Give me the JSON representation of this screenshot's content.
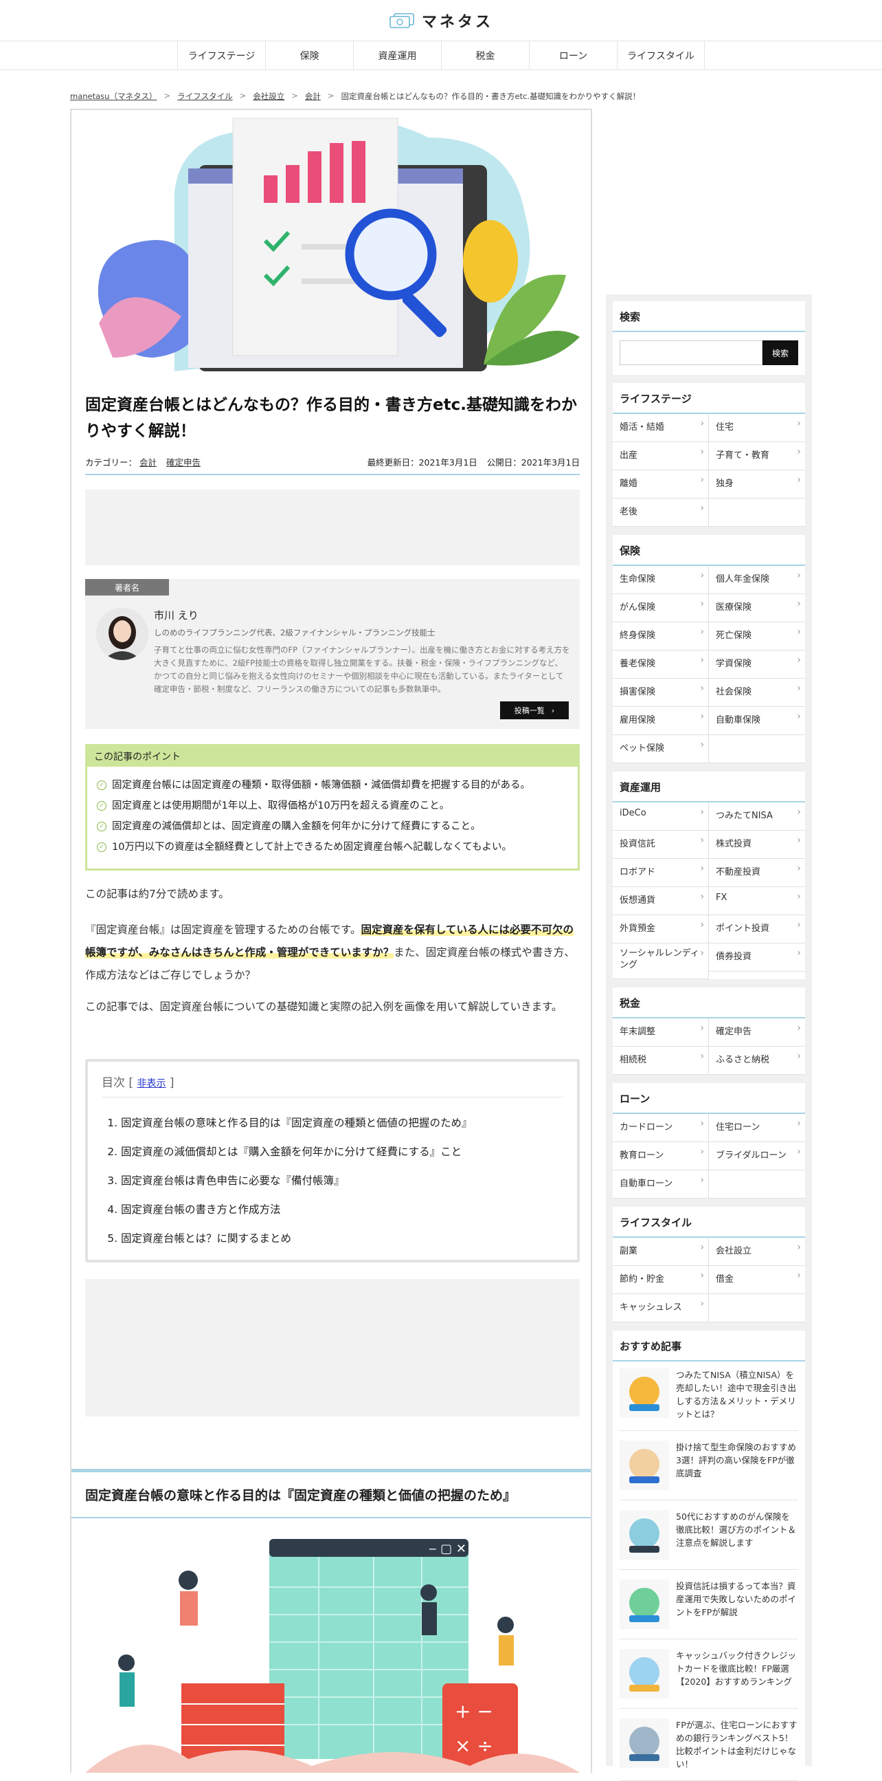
{
  "site": {
    "logo_text": "マネタス"
  },
  "nav": [
    "ライフステージ",
    "保険",
    "資産運用",
    "税金",
    "ローン",
    "ライフスタイル"
  ],
  "breadcrumb": [
    "manetasu（マネタス）",
    "ライフスタイル",
    "会社設立",
    "会計",
    "固定資産台帳とはどんなもの？作る目的・書き方etc.基礎知識をわかりやすく解説！"
  ],
  "breadcrumb_sep": ">",
  "article": {
    "title": "固定資産台帳とはどんなもの？作る目的・書き方etc.基礎知識をわかりやすく解説！",
    "category_label": "カテゴリー：",
    "categories": [
      "会計",
      "確定申告"
    ],
    "updated": "最終更新日：2021年3月1日",
    "published": "公開日：2021年3月1日",
    "author_tag": "著者名",
    "author_name": "市川 えり",
    "author_role": "しのめのライフプランニング代表、2級ファイナンシャル・プランニング技能士",
    "author_bio": "子育てと仕事の両立に悩む女性専門のFP（ファイナンシャルプランナー）。出産を機に働き方とお金に対する考え方を大きく見直すために、2級FP技能士の資格を取得し独立開業をする。扶養・税金・保険・ライフプランニングなど、かつての自分と同じ悩みを抱える女性向けのセミナーや個別相談を中心に現在も活動している。またライターとして確定申告・節税・制度など、フリーランスの働き方についての記事も多数執筆中。",
    "posts_button": "投稿一覧",
    "points_title": "この記事のポイント",
    "points": [
      "固定資産台帳には固定資産の種類・取得価額・帳簿価額・減価償却費を把握する目的がある。",
      "固定資産とは使用期間が1年以上、取得価格が10万円を超える資産のこと。",
      "固定資産の減価償却とは、固定資産の購入金額を何年かに分けて経費にすること。",
      "10万円以下の資産は全額経費として計上できるため固定資産台帳へ記載しなくてもよい。"
    ],
    "read_time": "この記事は約7分で読めます。",
    "intro_a": "『固定資産台帳』は固定資産を管理するための台帳です。",
    "intro_hl": "固定資産を保有している人には必要不可欠の帳簿ですが、みなさんはきちんと作成・管理ができていますか？",
    "intro_b": "また、固定資産台帳の様式や書き方、作成方法などはご存じでしょうか？",
    "intro2": "この記事では、固定資産台帳についての基礎知識と実際の記入例を画像を用いて解説していきます。",
    "toc_title": "目次",
    "toc_toggle": "非表示",
    "toc": [
      "固定資産台帳の意味と作る目的は『固定資産の種類と価値の把握のため』",
      "固定資産の減価償却とは『購入金額を何年かに分けて経費にする』こと",
      "固定資産台帳は青色申告に必要な『備付帳簿』",
      "固定資産台帳の書き方と作成方法",
      "固定資産台帳とは？に関するまとめ"
    ],
    "h2_1": "固定資産台帳の意味と作る目的は『固定資産の種類と価値の把握のため』"
  },
  "sidebar": {
    "search_title": "検索",
    "search_button": "検索",
    "categories": [
      {
        "title": "ライフステージ",
        "items": [
          "婚活・結婚",
          "住宅",
          "出産",
          "子育て・教育",
          "離婚",
          "独身",
          "老後",
          ""
        ]
      },
      {
        "title": "保険",
        "items": [
          "生命保険",
          "個人年金保険",
          "がん保険",
          "医療保険",
          "終身保険",
          "死亡保険",
          "養老保険",
          "学資保険",
          "損害保険",
          "社会保険",
          "雇用保険",
          "自動車保険",
          "ペット保険",
          ""
        ]
      },
      {
        "title": "資産運用",
        "items": [
          "iDeCo",
          "つみたてNISA",
          "投資信託",
          "株式投資",
          "ロボアド",
          "不動産投資",
          "仮想通貨",
          "FX",
          "外貨預金",
          "ポイント投資",
          "ソーシャルレンディング",
          "債券投資"
        ]
      },
      {
        "title": "税金",
        "items": [
          "年末調整",
          "確定申告",
          "相続税",
          "ふるさと納税"
        ]
      },
      {
        "title": "ローン",
        "items": [
          "カードローン",
          "住宅ローン",
          "教育ローン",
          "ブライダルローン",
          "自動車ローン",
          ""
        ]
      },
      {
        "title": "ライフスタイル",
        "items": [
          "副業",
          "会社設立",
          "節約・貯金",
          "借金",
          "キャッシュレス",
          ""
        ]
      }
    ],
    "rec_title": "おすすめ記事",
    "recommended": [
      "つみたてNISA（積立NISA）を売却したい！途中で現金引き出しする方法＆メリット・デメリットとは？",
      "掛け捨て型生命保険のおすすめ3選！評判の高い保険をFPが徹底調査",
      "50代におすすめのがん保険を徹底比較！選び方のポイント＆注意点を解説します",
      "投資信託は損するって本当？資産運用で失敗しないためのポイントをFPが解説",
      "キャッシュバック付きクレジットカードを徹底比較！FP厳選【2020】おすすめランキング",
      "FPが選ぶ、住宅ローンにおすすめの銀行ランキングベスト5！比較ポイントは金利だけじゃない！"
    ]
  }
}
